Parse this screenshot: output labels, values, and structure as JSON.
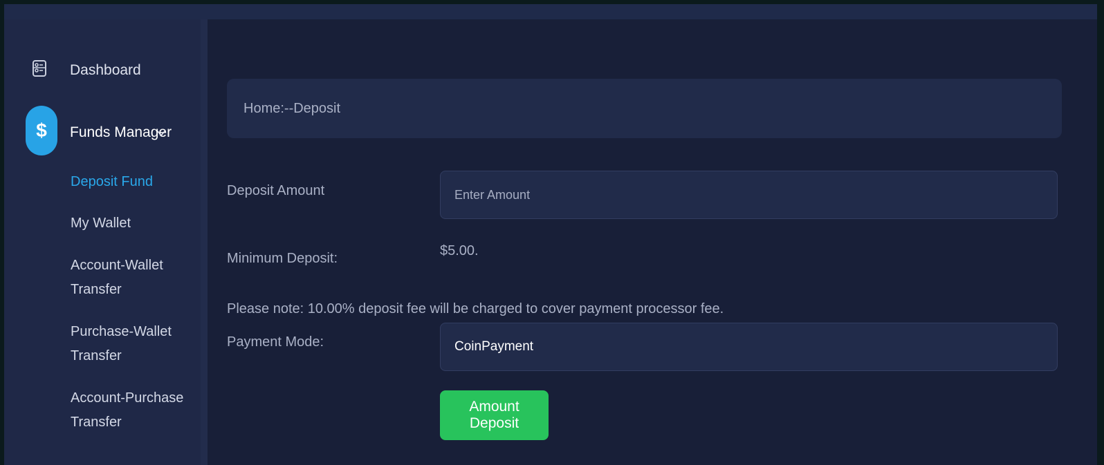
{
  "sidebar": {
    "dashboard_label": "Dashboard",
    "funds_manager_label": "Funds Manager",
    "funds_icon_glyph": "$",
    "sub_items": [
      {
        "label_line1": "Deposit Fund",
        "label_line2": ""
      },
      {
        "label_line1": "My Wallet",
        "label_line2": ""
      },
      {
        "label_line1": "Account-Wallet",
        "label_line2": "Transfer"
      },
      {
        "label_line1": "Purchase-Wallet",
        "label_line2": "Transfer"
      },
      {
        "label_line1": "Account-Purchase",
        "label_line2": "Transfer"
      }
    ]
  },
  "breadcrumb": {
    "text": "Home:--Deposit"
  },
  "form": {
    "deposit_amount_label": "Deposit Amount",
    "deposit_amount_placeholder": "Enter Amount",
    "deposit_amount_value": "",
    "minimum_deposit_label": "Minimum Deposit:",
    "minimum_deposit_value": "$5.00.",
    "note": "Please note: 10.00% deposit fee will be charged to cover payment processor fee.",
    "payment_mode_label": "Payment Mode:",
    "payment_mode_value": "CoinPayment",
    "submit_label": "Amount Deposit"
  },
  "colors": {
    "accent": "#28a3e6",
    "active_link": "#2aa8ea",
    "button": "#28c35c",
    "background": "#181f38"
  },
  "icons": {
    "dashboard": "dashboard-icon",
    "funds": "dollar-icon",
    "chevron": "chevron-down-icon"
  }
}
